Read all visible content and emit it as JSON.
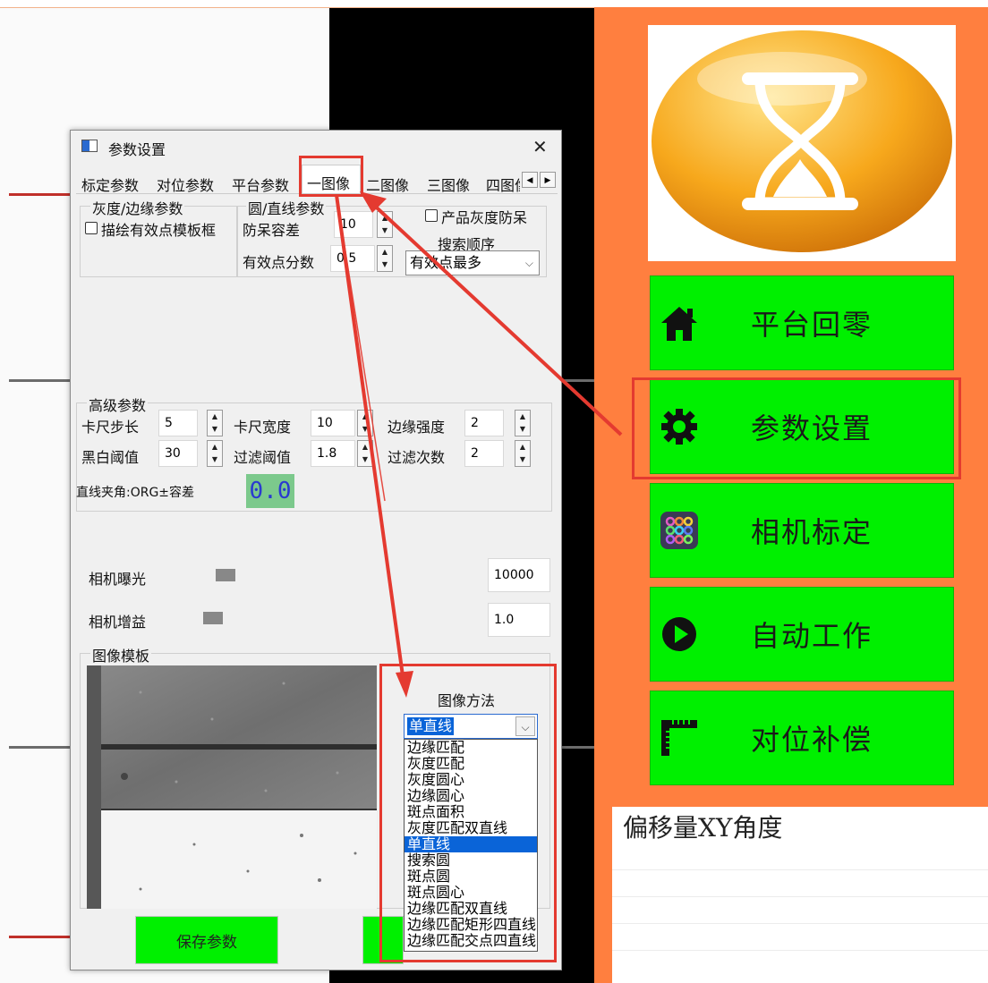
{
  "dialog": {
    "title": "参数设置",
    "tabs": [
      "标定参数",
      "对位参数",
      "平台参数",
      "一图像",
      "二图像",
      "三图像",
      "四图像"
    ],
    "gray_group": {
      "title": "灰度/边缘参数",
      "draw_checkbox_label": "描绘有效点模板框"
    },
    "circle_group": {
      "title": "圆/直线参数",
      "tolerance_label": "防呆容差",
      "tolerance_value": "10",
      "score_label": "有效点分数",
      "score_value": "0.5",
      "gray_proof_label": "产品灰度防呆",
      "search_order_label": "搜索顺序",
      "search_order_value": "有效点最多"
    },
    "advanced": {
      "title": "高级参数",
      "caliper_step_label": "卡尺步长",
      "caliper_step_value": "5",
      "caliper_width_label": "卡尺宽度",
      "caliper_width_value": "10",
      "edge_strength_label": "边缘强度",
      "edge_strength_value": "2",
      "bw_threshold_label": "黑白阈值",
      "bw_threshold_value": "30",
      "filter_threshold_label": "过滤阈值",
      "filter_threshold_value": "1.8",
      "filter_count_label": "过滤次数",
      "filter_count_value": "2",
      "line_angle_label": "直线夹角:ORG±容差",
      "line_angle_value": "0.0"
    },
    "exposure_label": "相机曝光",
    "exposure_value": "10000",
    "exposure_level": 0.0,
    "gain_label": "相机增益",
    "gain_value": "1.0",
    "gain_level": 0.0,
    "template_group": "图像模板",
    "image_method_label": "图像方法",
    "image_method_selected": "单直线",
    "image_method_options": [
      "边缘匹配",
      "灰度匹配",
      "灰度圆心",
      "边缘圆心",
      "斑点面积",
      "灰度匹配双直线",
      "单直线",
      "搜索圆",
      "斑点圆",
      "斑点圆心",
      "边缘匹配双直线",
      "边缘匹配矩形四直线",
      "边缘匹配交点四直线"
    ],
    "save_button": "保存参数",
    "close_glyph": "✕"
  },
  "side_buttons": [
    {
      "label": "平台回零",
      "icon": "home-icon"
    },
    {
      "label": "参数设置",
      "icon": "gear-icon"
    },
    {
      "label": "相机标定",
      "icon": "camera-grid-icon"
    },
    {
      "label": "自动工作",
      "icon": "play-icon"
    },
    {
      "label": "对位补偿",
      "icon": "ruler-icon"
    }
  ],
  "offset_title": "偏移量XY角度",
  "colors": {
    "button_green": "#00f000",
    "panel_orange": "#ff7f3f",
    "highlight_red": "#e43a30",
    "selection_blue": "#0a64d8"
  }
}
